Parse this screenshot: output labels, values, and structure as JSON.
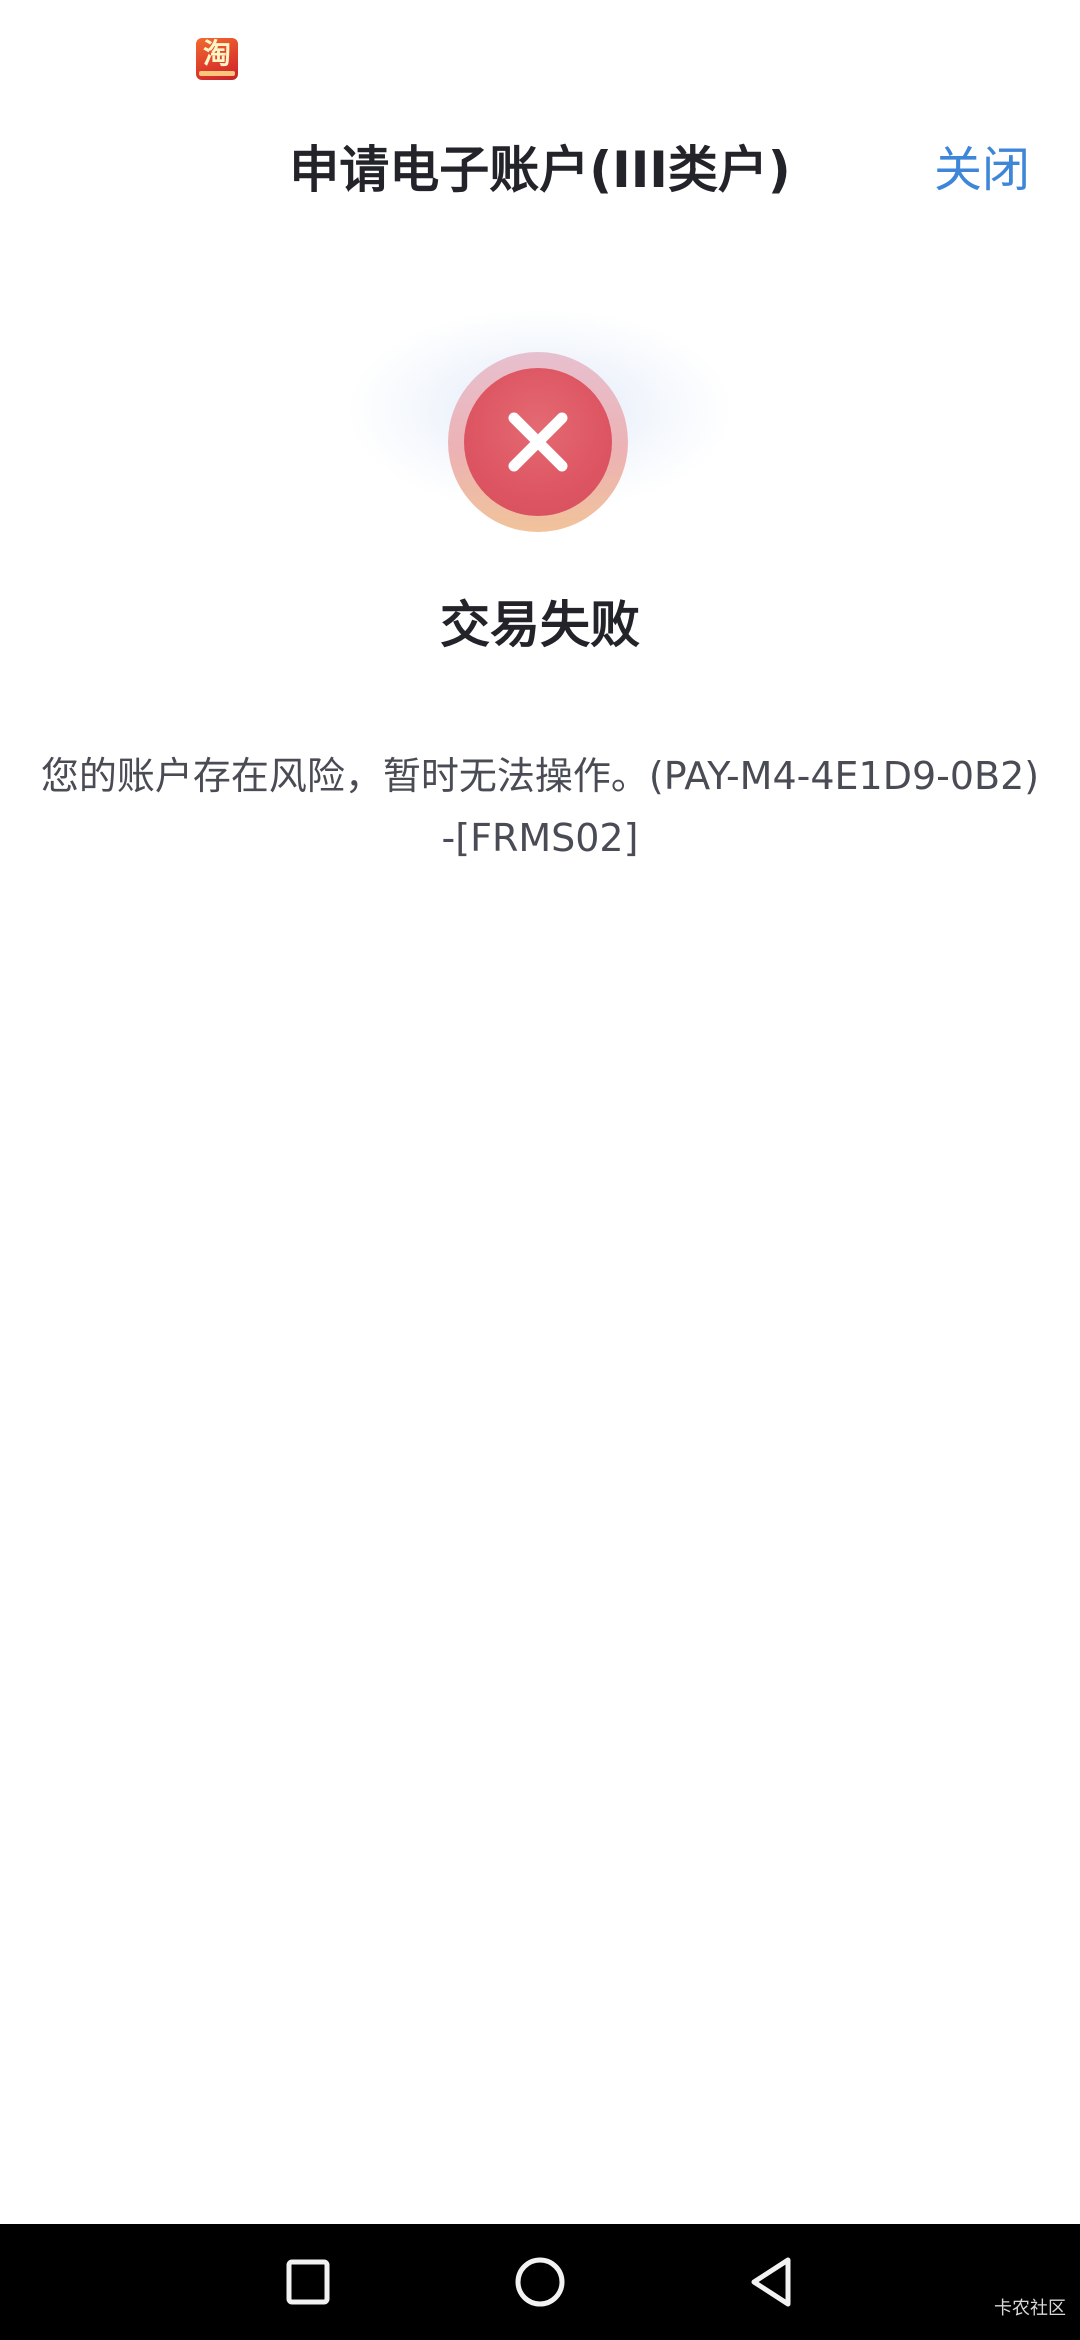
{
  "status_bar": {
    "app_icon": "taobao-app-icon",
    "app_icon_glyph": "淘"
  },
  "header": {
    "title": "申请电子账户(III类户)",
    "close_label": "关闭",
    "accent_color": "#3d86d8"
  },
  "result": {
    "icon": "close-icon",
    "status_color": "#dd5562",
    "title": "交易失败",
    "message": "您的账户存在风险，暂时无法操作。(PAY-M4-4E1D9-0B2)-[FRMS02]"
  },
  "nav_bar": {
    "recent_icon": "square-icon",
    "home_icon": "circle-icon",
    "back_icon": "triangle-back-icon",
    "watermark": "卡农社区"
  }
}
